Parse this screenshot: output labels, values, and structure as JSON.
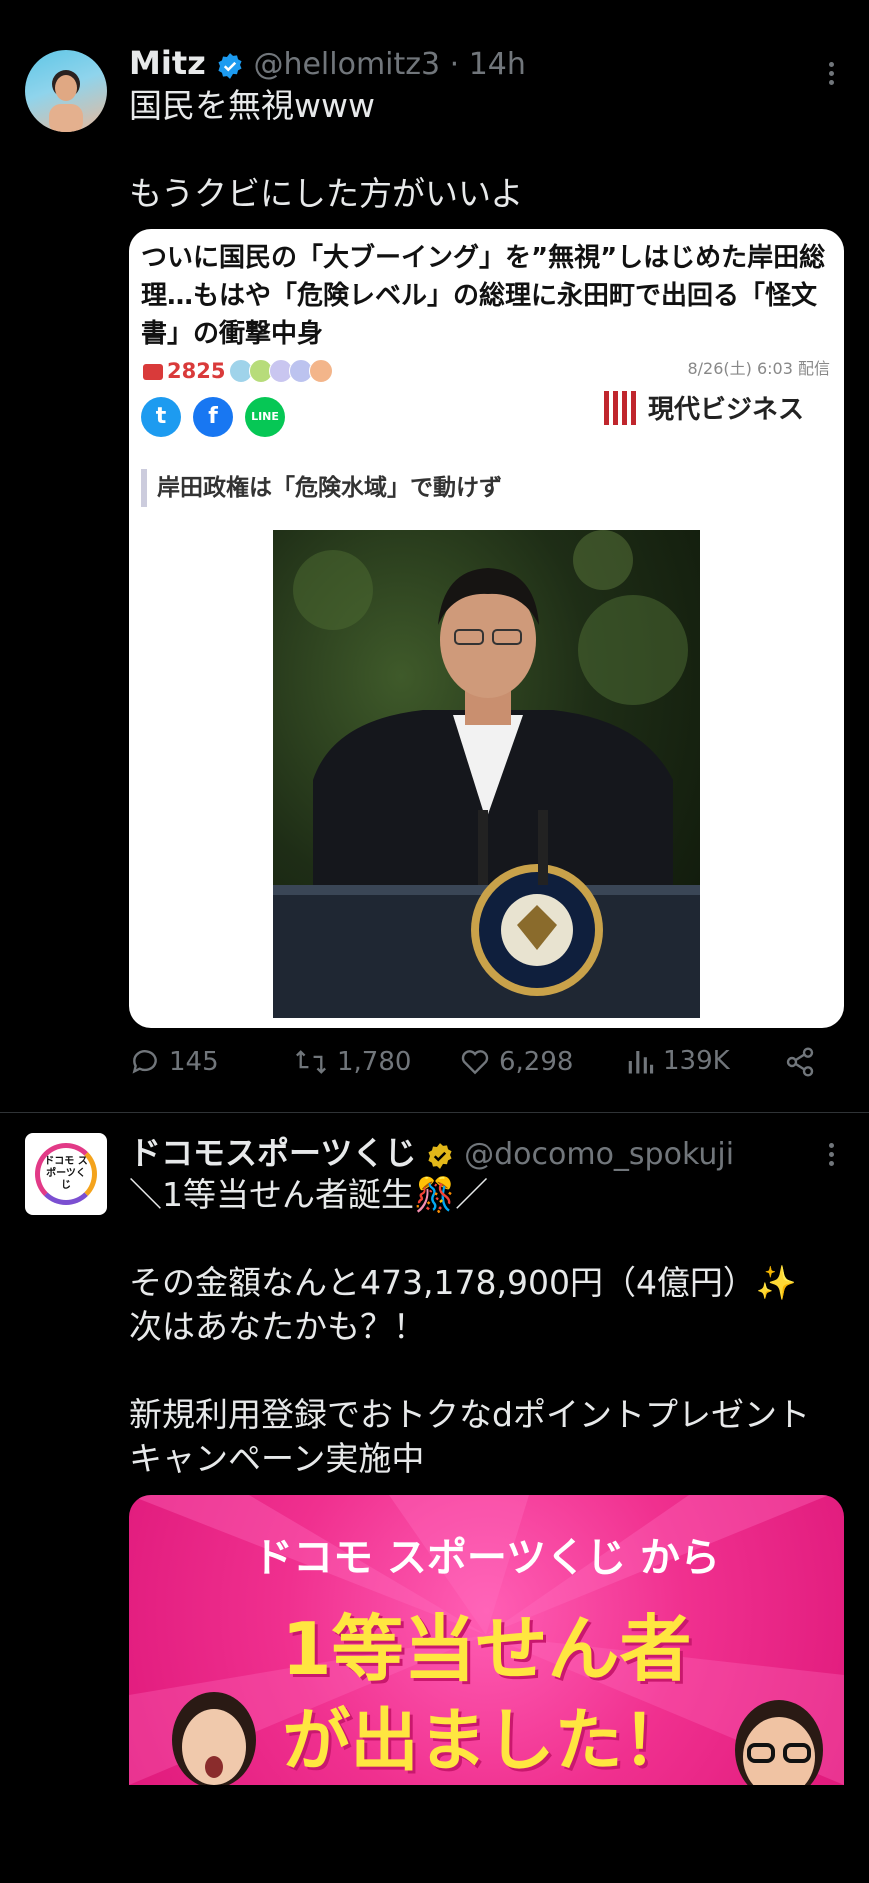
{
  "tweet1": {
    "name": "Mitz",
    "handle": "@hellomitz3 · 14h",
    "text_line1": "国民を無視www",
    "text_line2": "もうクビにした方がいいよ",
    "card": {
      "headline": "ついに国民の「大ブーイング」を”無視”しはじめた岸田総理…もはや「危険レベル」の総理に永田町で出回る「怪文書」の衝撃中身",
      "comment_count": "2825",
      "date": "8/26(土) 6:03 配信",
      "source": "現代ビジネス",
      "subheading": "岸田政権は「危険水域」で動けず",
      "twitter_icon": "t",
      "facebook_icon": "f",
      "line_icon": "LINE"
    },
    "actions": {
      "replies": "145",
      "retweets": "1,780",
      "likes": "6,298",
      "views": "139K"
    }
  },
  "tweet2": {
    "name": "ドコモスポーツくじ",
    "handle": "@docomo_spokuji",
    "avatar_text": "ドコモ スポーツくじ",
    "line1": "＼1等当せん者誕生🎊／",
    "line2": "その金額なんと473,178,900円（4億円）✨",
    "line3": "次はあなたかも？！",
    "line4": "新規利用登録でおトクなdポイントプレゼント",
    "line5": "キャンペーン実施中",
    "promo": {
      "l1": "ドコモ スポーツくじ から",
      "l2": "1等当せん者",
      "l3": "が出ました！"
    }
  },
  "colors": {
    "background": "#000000",
    "text": "#e7e9ea",
    "muted": "#71767b",
    "verified_blue": "#1d9bf0",
    "verified_gold": "#e2b719",
    "promo_pink": "#f0308f"
  }
}
